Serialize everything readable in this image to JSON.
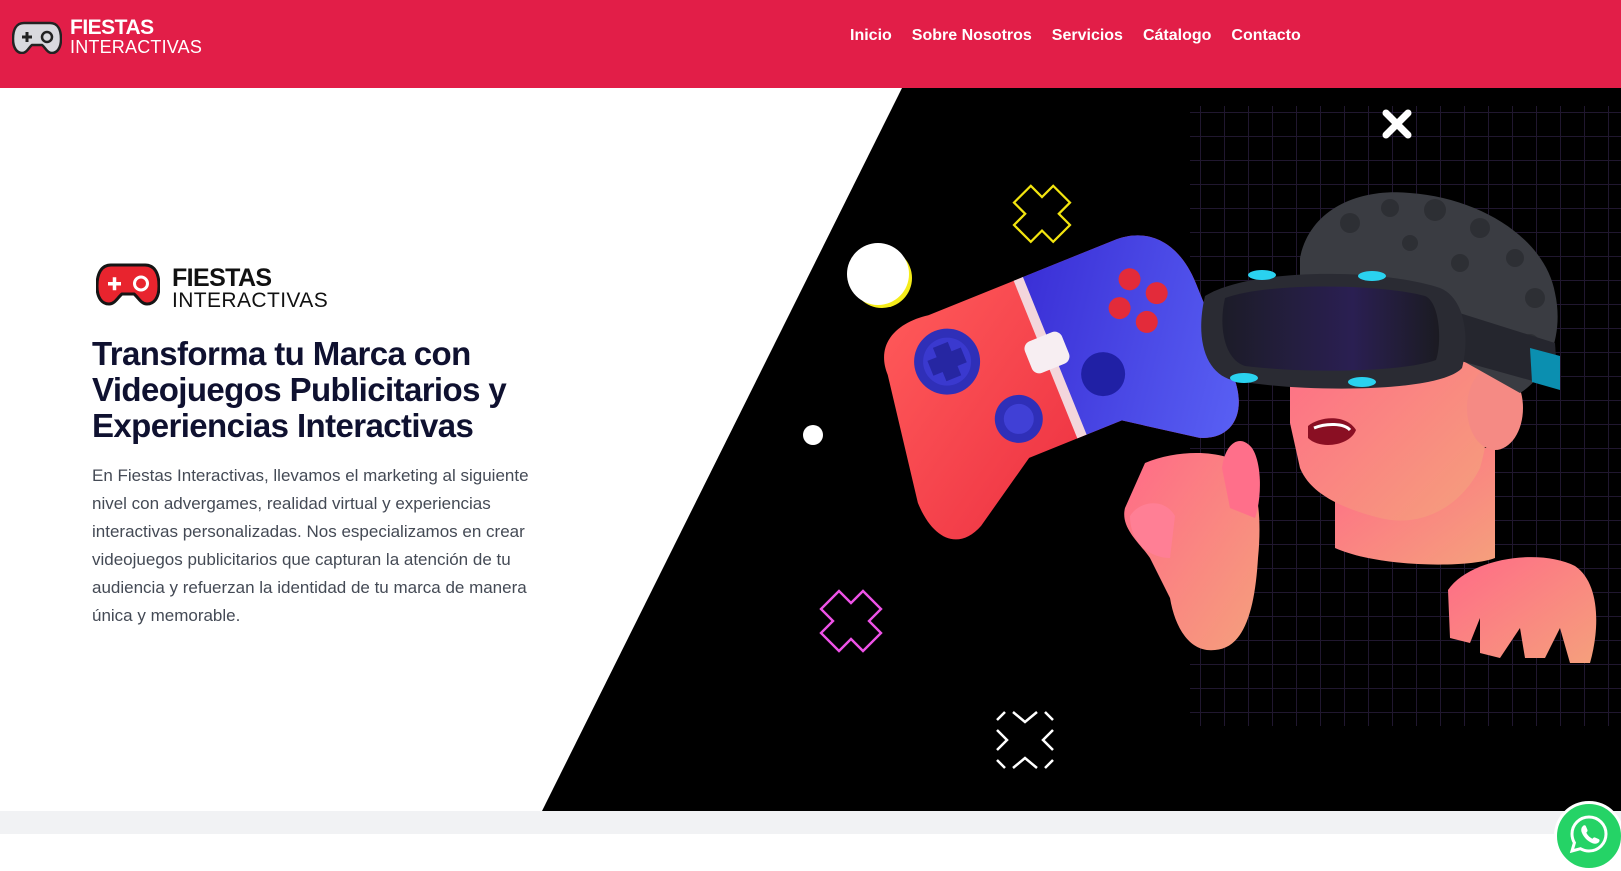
{
  "header": {
    "logo": {
      "line1": "FIESTAS",
      "line2": "INTERACTIVAS",
      "icon": "gamepad-icon"
    },
    "nav": [
      {
        "label": "Inicio"
      },
      {
        "label": "Sobre Nosotros"
      },
      {
        "label": "Servicios"
      },
      {
        "label": "Cátalogo"
      },
      {
        "label": "Contacto"
      }
    ]
  },
  "hero": {
    "brand": {
      "line1": "FIESTAS",
      "line2": "INTERACTIVAS",
      "icon": "gamepad-icon"
    },
    "title": "Transforma tu Marca con Videojuegos Publicitarios y Experiencias Interactivas",
    "description": "En Fiestas Interactivas, llevamos el marketing al siguiente nivel con advergames, realidad virtual y experiencias interactivas personalizadas. Nos especializamos en crear videojuegos publicitarios que capturan la atención de tu audiencia y refuerzan la identidad de tu marca de manera única y memorable.",
    "illustration": "vr-gamer-illustration"
  },
  "floating": {
    "icon": "whatsapp-icon"
  },
  "colors": {
    "brand_red": "#e21e48",
    "title_dark": "#0f1130",
    "body_text": "#444a55",
    "hero_black": "#000000",
    "whatsapp_green": "#25d366"
  }
}
